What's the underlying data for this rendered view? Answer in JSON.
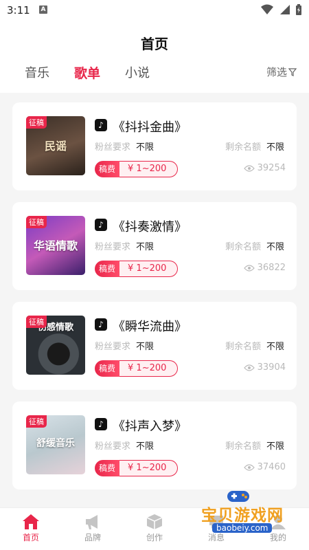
{
  "status_bar": {
    "time": "3:11",
    "notification_letter": "A"
  },
  "header": {
    "title": "首页",
    "tabs": [
      {
        "label": "音乐",
        "active": false
      },
      {
        "label": "歌单",
        "active": true
      },
      {
        "label": "小说",
        "active": false
      }
    ],
    "filter_label": "筛选"
  },
  "cards": [
    {
      "tag": "征稿",
      "cover_text": "民谣",
      "title": "《抖抖金曲》",
      "fans_label": "粉丝要求",
      "fans_value": "不限",
      "quota_label": "剩余名额",
      "quota_value": "不限",
      "fee_label": "稿费",
      "fee_value": "¥ 1~200",
      "views": "39254"
    },
    {
      "tag": "征稿",
      "cover_text": "华语情歌",
      "title": "《抖奏激情》",
      "fans_label": "粉丝要求",
      "fans_value": "不限",
      "quota_label": "剩余名额",
      "quota_value": "不限",
      "fee_label": "稿费",
      "fee_value": "¥ 1~200",
      "views": "36822"
    },
    {
      "tag": "征稿",
      "cover_text": "伤感情歌",
      "title": "《瞬华流曲》",
      "fans_label": "粉丝要求",
      "fans_value": "不限",
      "quota_label": "剩余名额",
      "quota_value": "不限",
      "fee_label": "稿费",
      "fee_value": "¥ 1~200",
      "views": "33904"
    },
    {
      "tag": "征稿",
      "cover_text": "舒缓音乐",
      "title": "《抖声入梦》",
      "fans_label": "粉丝要求",
      "fans_value": "不限",
      "quota_label": "剩余名额",
      "quota_value": "不限",
      "fee_label": "稿费",
      "fee_value": "¥ 1~200",
      "views": "37460"
    }
  ],
  "bottom_nav": [
    {
      "label": "首页",
      "icon": "home-icon",
      "active": true
    },
    {
      "label": "品牌",
      "icon": "megaphone-icon",
      "active": false
    },
    {
      "label": "创作",
      "icon": "cube-icon",
      "active": false
    },
    {
      "label": "消息",
      "icon": "message-icon",
      "active": false
    },
    {
      "label": "我的",
      "icon": "user-icon",
      "active": false
    }
  ],
  "watermark": {
    "text": "宝贝游戏网",
    "url": "baobeiy.com"
  },
  "colors": {
    "accent": "#e8264a",
    "background": "#f5f5f5"
  }
}
